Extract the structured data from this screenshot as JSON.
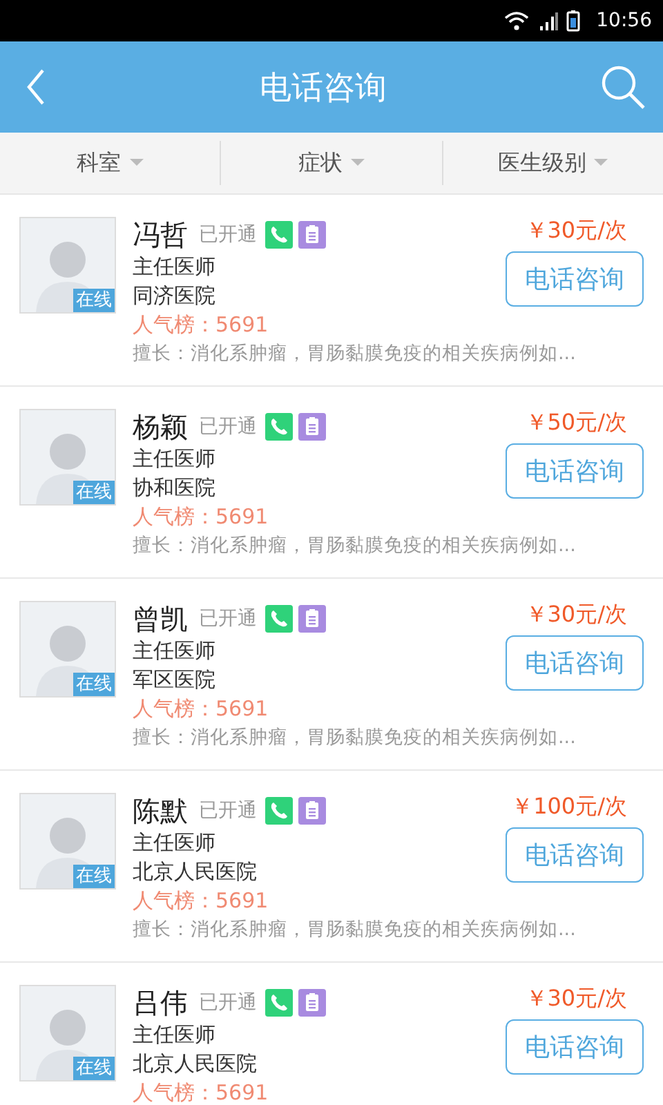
{
  "status_bar": {
    "time": "10:56"
  },
  "header": {
    "title": "电话咨询"
  },
  "filters": [
    {
      "label": "科室"
    },
    {
      "label": "症状"
    },
    {
      "label": "医生级别"
    }
  ],
  "doctors": [
    {
      "name": "冯哲",
      "service": "已开通",
      "badge": "在线",
      "title": "主任医师",
      "hospital": "同济医院",
      "popularity": "人气榜：5691",
      "specialty": "擅长：消化系肿瘤，胃肠黏膜免疫的相关疾病例如...",
      "price": "￥30元/次",
      "button": "电话咨询"
    },
    {
      "name": "杨颖",
      "service": "已开通",
      "badge": "在线",
      "title": "主任医师",
      "hospital": "协和医院",
      "popularity": "人气榜：5691",
      "specialty": "擅长：消化系肿瘤，胃肠黏膜免疫的相关疾病例如...",
      "price": "￥50元/次",
      "button": "电话咨询"
    },
    {
      "name": "曾凯",
      "service": "已开通",
      "badge": "在线",
      "title": "主任医师",
      "hospital": "军区医院",
      "popularity": "人气榜：5691",
      "specialty": "擅长：消化系肿瘤，胃肠黏膜免疫的相关疾病例如...",
      "price": "￥30元/次",
      "button": "电话咨询"
    },
    {
      "name": "陈默",
      "service": "已开通",
      "badge": "在线",
      "title": "主任医师",
      "hospital": "北京人民医院",
      "popularity": "人气榜：5691",
      "specialty": "擅长：消化系肿瘤，胃肠黏膜免疫的相关疾病例如...",
      "price": "￥100元/次",
      "button": "电话咨询"
    },
    {
      "name": "吕伟",
      "service": "已开通",
      "badge": "在线",
      "title": "主任医师",
      "hospital": "北京人民医院",
      "popularity": "人气榜：5691",
      "price": "￥30元/次",
      "button": "电话咨询"
    }
  ]
}
